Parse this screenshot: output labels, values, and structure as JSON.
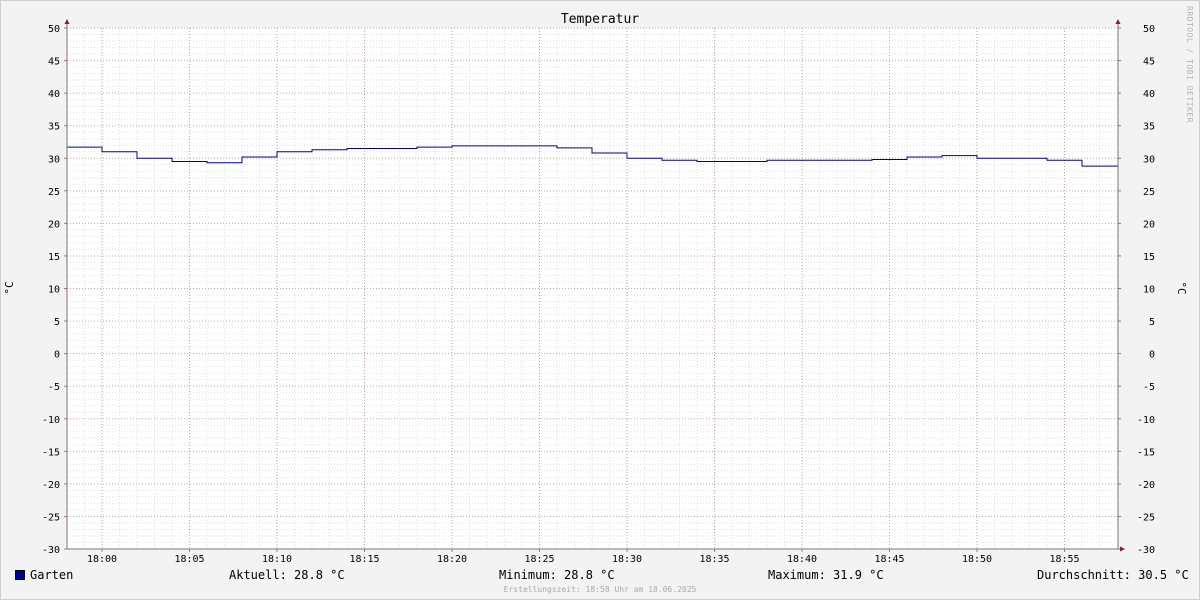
{
  "chart_data": {
    "type": "line",
    "title": "Temperatur",
    "ylabel": "°C",
    "ylim": [
      -30,
      50
    ],
    "y_ticks": [
      50,
      45,
      40,
      35,
      30,
      25,
      20,
      15,
      10,
      5,
      0,
      -5,
      -10,
      -15,
      -20,
      -25,
      -30
    ],
    "x_ticks": [
      "18:00",
      "18:05",
      "18:10",
      "18:15",
      "18:20",
      "18:25",
      "18:30",
      "18:35",
      "18:40",
      "18:45",
      "18:50",
      "18:55"
    ],
    "grid": true,
    "series": [
      {
        "name": "Garten",
        "color": "#000099",
        "time": [
          "17:58",
          "18:00",
          "18:02",
          "18:04",
          "18:06",
          "18:08",
          "18:10",
          "18:12",
          "18:14",
          "18:16",
          "18:18",
          "18:20",
          "18:22",
          "18:24",
          "18:26",
          "18:28",
          "18:30",
          "18:32",
          "18:34",
          "18:36",
          "18:38",
          "18:40",
          "18:42",
          "18:44",
          "18:46",
          "18:48",
          "18:50",
          "18:52",
          "18:54",
          "18:56"
        ],
        "values": [
          31.7,
          31.0,
          30.0,
          29.5,
          29.3,
          30.2,
          31.0,
          31.3,
          31.5,
          31.5,
          31.7,
          31.9,
          31.9,
          31.9,
          31.6,
          30.8,
          30.0,
          29.7,
          29.5,
          29.5,
          29.7,
          29.7,
          29.7,
          29.8,
          30.2,
          30.4,
          30.0,
          30.0,
          29.7,
          28.8
        ]
      }
    ]
  },
  "legend": {
    "name": "Garten",
    "color": "#000099",
    "current": "Aktuell: 28.8 °C",
    "minimum": "Minimum: 28.8 °C",
    "maximum": "Maximum: 31.9 °C",
    "average": "Durchschnitt: 30.5 °C"
  },
  "footer": "Erstellungszeit: 18:58 Uhr am 18.06.2025",
  "watermark": "RRDTOOL / TOBI OETIKER"
}
